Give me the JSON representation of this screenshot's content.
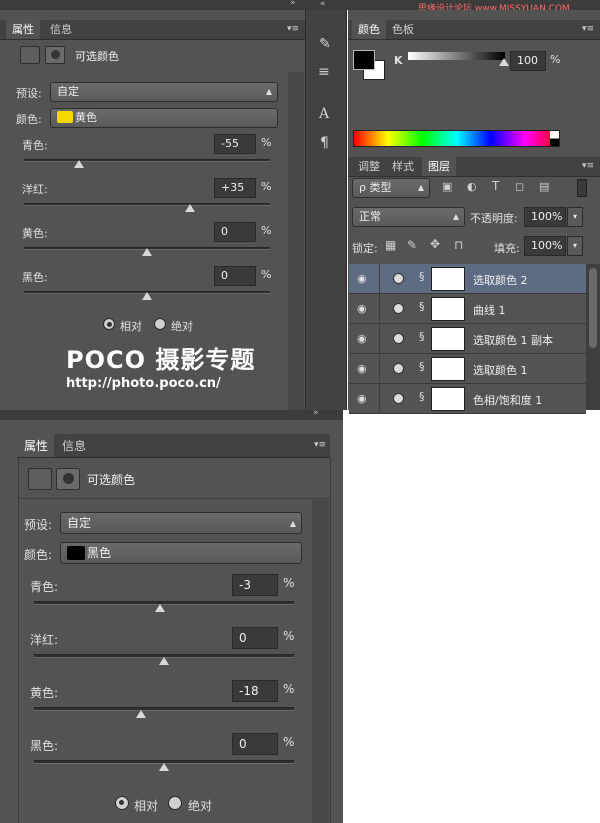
{
  "watermark": "思缘设计论坛 www.MISSYUAN.COM",
  "top_panel": {
    "tabs": [
      "属性",
      "信息"
    ],
    "title": "可选颜色",
    "preset_label": "预设:",
    "preset_value": "自定",
    "color_label": "颜色:",
    "color_value": "黄色",
    "swatch_color": "#f5d800",
    "sliders": [
      {
        "label": "青色:",
        "value": "-55",
        "unit": "%",
        "level": -0.55
      },
      {
        "label": "洋红:",
        "value": "+35",
        "unit": "%",
        "level": 0.35
      },
      {
        "label": "黄色:",
        "value": "0",
        "unit": "%",
        "level": 0
      },
      {
        "label": "黑色:",
        "value": "0",
        "unit": "%",
        "level": 0
      }
    ],
    "radio_relative": "相对",
    "radio_absolute": "绝对",
    "logo_text": "POCO 摄影专题",
    "logo_url": "http://photo.poco.cn/"
  },
  "color_panel": {
    "tabs": [
      "颜色",
      "色板"
    ],
    "channel": "K",
    "value": "100",
    "level": 1.0
  },
  "layers_panel": {
    "tabs": [
      "调整",
      "样式",
      "图层"
    ],
    "filter_label": "ρ 类型",
    "blend_mode": "正常",
    "opacity_label": "不透明度:",
    "opacity_value": "100%",
    "lock_label": "锁定:",
    "fill_label": "填充:",
    "fill_value": "100%",
    "layers": [
      {
        "name": "选取颜色 2",
        "selected": true
      },
      {
        "name": "曲线 1",
        "selected": false
      },
      {
        "name": "选取颜色 1 副本",
        "selected": false
      },
      {
        "name": "选取颜色 1",
        "selected": false
      },
      {
        "name": "色相/饱和度 1",
        "selected": false
      }
    ]
  },
  "bottom_panel": {
    "tabs": [
      "属性",
      "信息"
    ],
    "title": "可选颜色",
    "preset_label": "预设:",
    "preset_value": "自定",
    "color_label": "颜色:",
    "color_value": "黑色",
    "swatch_color": "#000000",
    "sliders": [
      {
        "label": "青色:",
        "value": "-3",
        "unit": "%",
        "level": -0.03
      },
      {
        "label": "洋红:",
        "value": "0",
        "unit": "%",
        "level": 0
      },
      {
        "label": "黄色:",
        "value": "-18",
        "unit": "%",
        "level": -0.18
      },
      {
        "label": "黑色:",
        "value": "0",
        "unit": "%",
        "level": 0
      }
    ],
    "radio_relative": "相对",
    "radio_absolute": "绝对"
  }
}
